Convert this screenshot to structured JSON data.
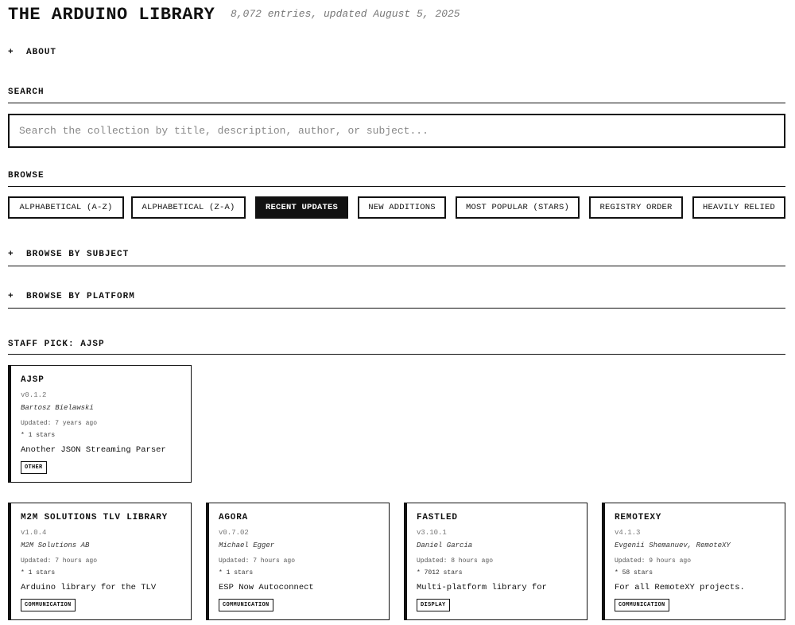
{
  "header": {
    "title": "THE ARDUINO LIBRARY",
    "subtitle": "8,072 entries, updated August 5, 2025"
  },
  "about": {
    "toggle": "+",
    "label": "ABOUT"
  },
  "search": {
    "label": "SEARCH",
    "value": "",
    "placeholder": "Search the collection by title, description, author, or subject..."
  },
  "browse": {
    "label": "BROWSE",
    "buttons": [
      {
        "label": "ALPHABETICAL (A-Z)",
        "active": false
      },
      {
        "label": "ALPHABETICAL (Z-A)",
        "active": false
      },
      {
        "label": "RECENT UPDATES",
        "active": true
      },
      {
        "label": "NEW ADDITIONS",
        "active": false
      },
      {
        "label": "MOST POPULAR (STARS)",
        "active": false
      },
      {
        "label": "REGISTRY ORDER",
        "active": false
      },
      {
        "label": "HEAVILY RELIED",
        "active": false
      }
    ]
  },
  "browse_subject": {
    "toggle": "+",
    "label": "BROWSE BY SUBJECT"
  },
  "browse_platform": {
    "toggle": "+",
    "label": "BROWSE BY PLATFORM"
  },
  "staff_pick": {
    "label": "STAFF PICK: AJSP",
    "card": {
      "name": "AJSP",
      "version": "v0.1.2",
      "author": "Bartosz Bielawski",
      "updated": "Updated: 7 years ago",
      "stars": "* 1 stars",
      "description": "Another JSON Streaming Parser",
      "tag": "OTHER"
    }
  },
  "results": [
    {
      "name": "M2M SOLUTIONS TLV LIBRARY",
      "version": "v1.0.4",
      "author": "M2M Solutions AB",
      "updated": "Updated: 7 hours ago",
      "stars": "* 1 stars",
      "description": "Arduino library for the TLV",
      "tag": "COMMUNICATION"
    },
    {
      "name": "AGORA",
      "version": "v0.7.02",
      "author": "Michael Egger",
      "updated": "Updated: 7 hours ago",
      "stars": "* 1 stars",
      "description": "ESP Now Autoconnect",
      "tag": "COMMUNICATION"
    },
    {
      "name": "FASTLED",
      "version": "v3.10.1",
      "author": "Daniel Garcia",
      "updated": "Updated: 8 hours ago",
      "stars": "* 7012 stars",
      "description": "Multi-platform library for",
      "tag": "DISPLAY"
    },
    {
      "name": "REMOTEXY",
      "version": "v4.1.3",
      "author": "Evgenii Shemanuev, RemoteXY",
      "updated": "Updated: 9 hours ago",
      "stars": "* 58 stars",
      "description": "For all RemoteXY projects.",
      "tag": "COMMUNICATION"
    }
  ]
}
